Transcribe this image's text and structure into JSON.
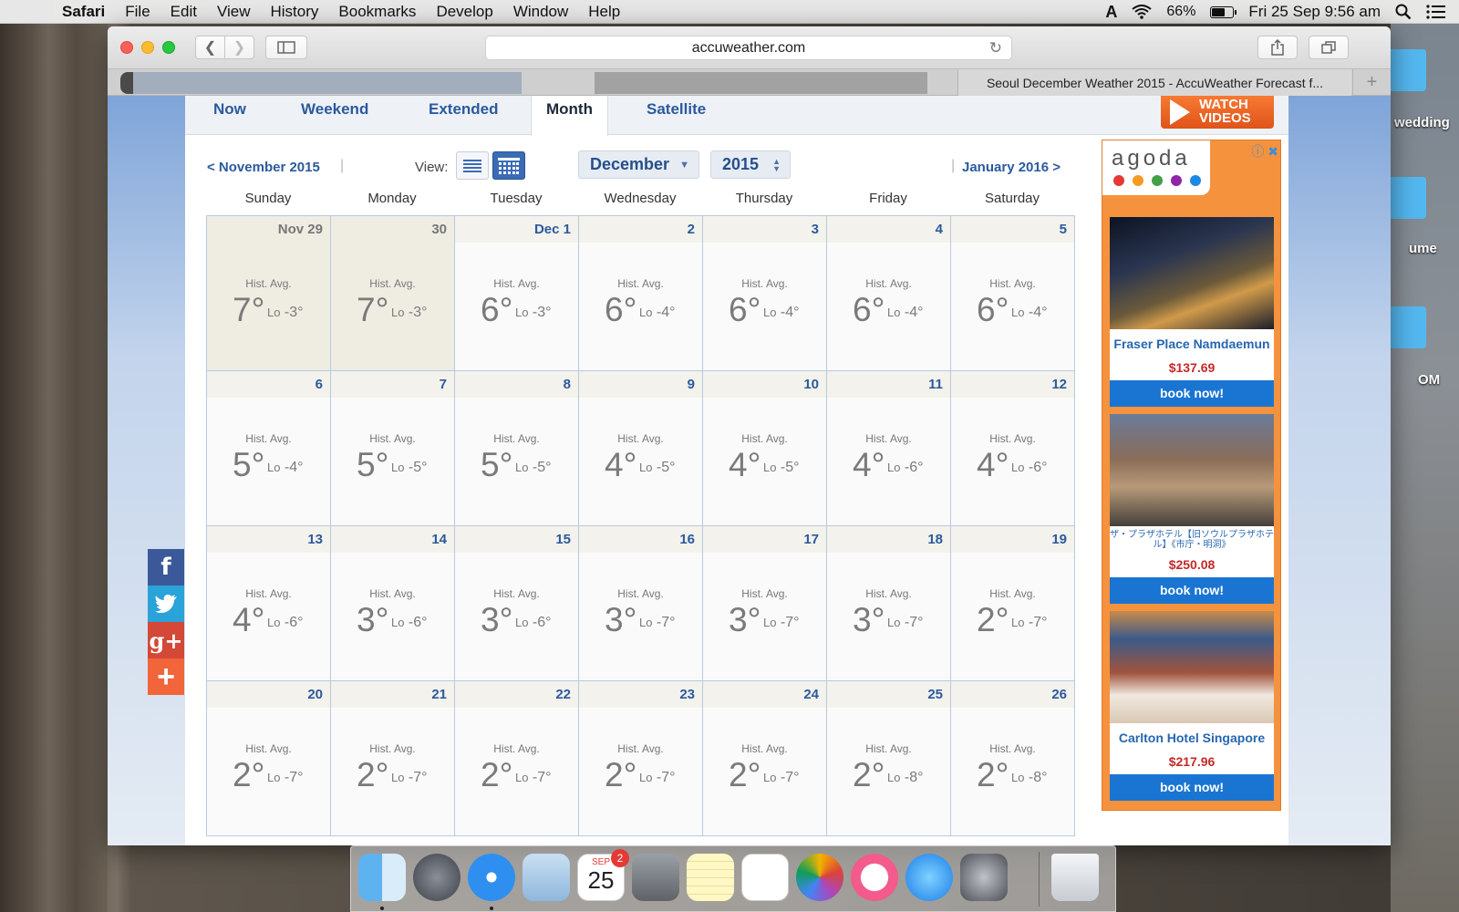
{
  "menubar": {
    "app": "Safari",
    "items": [
      "File",
      "Edit",
      "View",
      "History",
      "Bookmarks",
      "Develop",
      "Window",
      "Help"
    ],
    "battery_pct": "66%",
    "battery_level": 0.66,
    "datetime": "Fri 25 Sep  9:56 am"
  },
  "desktop": {
    "labels": [
      "wedding",
      "ume",
      "OM"
    ]
  },
  "browser": {
    "url": "accuweather.com",
    "active_tab_title": "Seoul December Weather 2015 - AccuWeather Forecast f...",
    "new_tab": "+"
  },
  "subnav": {
    "tabs": [
      "Now",
      "Weekend",
      "Extended",
      "Month",
      "Satellite"
    ],
    "active": "Month",
    "watch_line1": "WATCH",
    "watch_line2": "VIDEOS"
  },
  "calendar": {
    "prev_link": "< November 2015",
    "next_link": "January 2016 >",
    "view_label": "View:",
    "month_select": "December",
    "year_select": "2015",
    "days_of_week": [
      "Sunday",
      "Monday",
      "Tuesday",
      "Wednesday",
      "Thursday",
      "Friday",
      "Saturday"
    ],
    "hist_label": "Hist. Avg.",
    "lo_label": "Lo",
    "weeks": [
      [
        {
          "date": "Nov 29",
          "hi": "7°",
          "lo": "-3°",
          "past": true
        },
        {
          "date": "30",
          "hi": "7°",
          "lo": "-3°",
          "past": true
        },
        {
          "date": "Dec 1",
          "hi": "6°",
          "lo": "-3°"
        },
        {
          "date": "2",
          "hi": "6°",
          "lo": "-4°"
        },
        {
          "date": "3",
          "hi": "6°",
          "lo": "-4°"
        },
        {
          "date": "4",
          "hi": "6°",
          "lo": "-4°"
        },
        {
          "date": "5",
          "hi": "6°",
          "lo": "-4°"
        }
      ],
      [
        {
          "date": "6",
          "hi": "5°",
          "lo": "-4°"
        },
        {
          "date": "7",
          "hi": "5°",
          "lo": "-5°"
        },
        {
          "date": "8",
          "hi": "5°",
          "lo": "-5°"
        },
        {
          "date": "9",
          "hi": "4°",
          "lo": "-5°"
        },
        {
          "date": "10",
          "hi": "4°",
          "lo": "-5°"
        },
        {
          "date": "11",
          "hi": "4°",
          "lo": "-6°"
        },
        {
          "date": "12",
          "hi": "4°",
          "lo": "-6°"
        }
      ],
      [
        {
          "date": "13",
          "hi": "4°",
          "lo": "-6°"
        },
        {
          "date": "14",
          "hi": "3°",
          "lo": "-6°"
        },
        {
          "date": "15",
          "hi": "3°",
          "lo": "-6°"
        },
        {
          "date": "16",
          "hi": "3°",
          "lo": "-7°"
        },
        {
          "date": "17",
          "hi": "3°",
          "lo": "-7°"
        },
        {
          "date": "18",
          "hi": "3°",
          "lo": "-7°"
        },
        {
          "date": "19",
          "hi": "2°",
          "lo": "-7°"
        }
      ],
      [
        {
          "date": "20",
          "hi": "2°",
          "lo": "-7°"
        },
        {
          "date": "21",
          "hi": "2°",
          "lo": "-7°"
        },
        {
          "date": "22",
          "hi": "2°",
          "lo": "-7°"
        },
        {
          "date": "23",
          "hi": "2°",
          "lo": "-7°"
        },
        {
          "date": "24",
          "hi": "2°",
          "lo": "-7°"
        },
        {
          "date": "25",
          "hi": "2°",
          "lo": "-8°"
        },
        {
          "date": "26",
          "hi": "2°",
          "lo": "-8°"
        }
      ]
    ]
  },
  "social": [
    "f",
    "twitter",
    "g+",
    "+"
  ],
  "ad": {
    "brand": "agoda",
    "hotels": [
      {
        "name": "Fraser Place Namdaemun",
        "price": "$137.69",
        "cta": "book now!"
      },
      {
        "name": "ザ・プラザホテル【旧ソウルプラザホテル】《市庁・明洞》",
        "price": "$250.08",
        "cta": "book now!"
      },
      {
        "name": "Carlton Hotel Singapore",
        "price": "$217.96",
        "cta": "book now!"
      }
    ]
  },
  "dock": {
    "calendar_month": "SEP",
    "calendar_day": "25",
    "calendar_badge": "2"
  },
  "colors": {
    "link_blue": "#2b5a9d",
    "agoda_orange": "#f5923e",
    "book_blue": "#1a75d2",
    "price_red": "#c62828"
  }
}
